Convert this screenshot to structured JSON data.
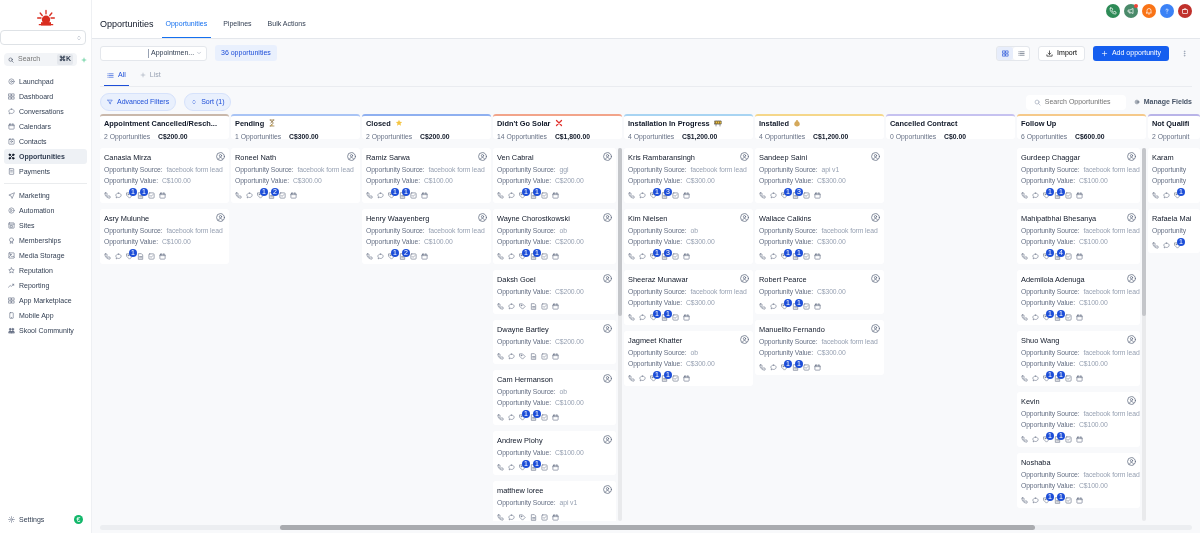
{
  "sidebar": {
    "search": {
      "placeholder": "Search",
      "shortcut": "⌘K"
    },
    "sections": [
      {
        "items": [
          {
            "label": "Launchpad",
            "selected": false
          },
          {
            "label": "Dashboard",
            "selected": false
          },
          {
            "label": "Conversations",
            "selected": false
          },
          {
            "label": "Calendars",
            "selected": false
          },
          {
            "label": "Contacts",
            "selected": false
          },
          {
            "label": "Opportunities",
            "selected": true
          },
          {
            "label": "Payments",
            "selected": false
          }
        ]
      },
      {
        "items": [
          {
            "label": "Marketing",
            "selected": false
          },
          {
            "label": "Automation",
            "selected": false
          },
          {
            "label": "Sites",
            "selected": false
          },
          {
            "label": "Memberships",
            "selected": false
          },
          {
            "label": "Media Storage",
            "selected": false
          },
          {
            "label": "Reputation",
            "selected": false
          },
          {
            "label": "Reporting",
            "selected": false
          },
          {
            "label": "App Marketplace",
            "selected": false
          },
          {
            "label": "Mobile App",
            "selected": false
          },
          {
            "label": "Skool Community",
            "selected": false
          }
        ]
      }
    ],
    "settings": {
      "label": "Settings",
      "badge": "€"
    }
  },
  "header": {
    "title": "Opportunities",
    "tabs": [
      {
        "label": "Opportunities",
        "selected": true
      },
      {
        "label": "Pipelines",
        "selected": false
      },
      {
        "label": "Bulk Actions",
        "selected": false
      }
    ]
  },
  "toolbar": {
    "pipeline": "Appointmen...",
    "count": "36 opportunities",
    "views": [
      {
        "kind": "grid",
        "selected": true
      },
      {
        "kind": "list",
        "selected": false
      }
    ],
    "import": "Import",
    "add": "Add opportunity"
  },
  "subtabs": [
    {
      "label": "All",
      "selected": true,
      "disabled": false
    },
    {
      "label": "List",
      "selected": false,
      "disabled": true
    }
  ],
  "filters": {
    "advanced": "Advanced Filters",
    "sort": "Sort (1)",
    "search_placeholder": "Search Opportunities",
    "manage": "Manage Fields"
  },
  "columns": [
    {
      "title": "Appointment Cancelled/Resch...",
      "color": "#c9b8ab",
      "count": "2 Opportunities",
      "total": "C$200.00",
      "cards": [
        {
          "name": "Canasia Mirza",
          "fields": [
            {
              "label": "Opportunity Source:",
              "value": "facebook form lead"
            },
            {
              "label": "Opportunity Value:",
              "value": "C$100.00"
            }
          ],
          "tag_badge": "1",
          "note_badge": "1"
        },
        {
          "name": "Asry Mulunhe",
          "fields": [
            {
              "label": "Opportunity Source:",
              "value": "facebook form lead"
            },
            {
              "label": "Opportunity Value:",
              "value": "C$100.00"
            }
          ],
          "tag_badge": "1"
        }
      ]
    },
    {
      "title": "Pending",
      "color": "#a9c4f5",
      "count": "1 Opportunities",
      "total": "C$300.00",
      "cards": [
        {
          "name": "Roneel Nath",
          "fields": [
            {
              "label": "Opportunity Source:",
              "value": "facebook form lead"
            },
            {
              "label": "Opportunity Value:",
              "value": "C$300.00"
            }
          ],
          "tag_badge": "1",
          "note_badge": "2"
        }
      ]
    },
    {
      "title": "Closed",
      "color": "#8fb0f0",
      "count": "2 Opportunities",
      "total": "C$200.00",
      "cards": [
        {
          "name": "Ramiz Sarwa",
          "fields": [
            {
              "label": "Opportunity Source:",
              "value": "facebook form lead"
            },
            {
              "label": "Opportunity Value:",
              "value": "C$100.00"
            }
          ],
          "tag_badge": "1",
          "note_badge": "1"
        },
        {
          "name": "Henry Waayenberg",
          "fields": [
            {
              "label": "Opportunity Source:",
              "value": "facebook form lead"
            },
            {
              "label": "Opportunity Value:",
              "value": "C$100.00"
            }
          ],
          "tag_badge": "1",
          "note_badge": "2"
        }
      ]
    },
    {
      "title": "Didn't Go Solar",
      "color": "#f2a48a",
      "count": "14 Opportunities",
      "total": "C$1,800.00",
      "cards": [
        {
          "name": "Ven Cabral",
          "fields": [
            {
              "label": "Opportunity Source:",
              "value": "ggl"
            },
            {
              "label": "Opportunity Value:",
              "value": "C$200.00"
            }
          ],
          "tag_badge": "1",
          "note_badge": "1"
        },
        {
          "name": "Wayne Chorostkowski",
          "fields": [
            {
              "label": "Opportunity Source:",
              "value": "ob"
            },
            {
              "label": "Opportunity Value:",
              "value": "C$200.00"
            }
          ],
          "tag_badge": "1",
          "note_badge": "1"
        },
        {
          "name": "Daksh Goel",
          "fields": [
            {
              "label": "Opportunity Value:",
              "value": "C$200.00"
            }
          ]
        },
        {
          "name": "Dwayne Bartley",
          "fields": [
            {
              "label": "Opportunity Value:",
              "value": "C$200.00"
            }
          ]
        },
        {
          "name": "Cam Hermanson",
          "fields": [
            {
              "label": "Opportunity Source:",
              "value": "ob"
            },
            {
              "label": "Opportunity Value:",
              "value": "C$100.00"
            }
          ],
          "tag_badge": "1",
          "note_badge": "1"
        },
        {
          "name": "Andrew Plohy",
          "fields": [
            {
              "label": "Opportunity Value:",
              "value": "C$100.00"
            }
          ],
          "tag_badge": "1",
          "note_badge": "1"
        },
        {
          "name": "matthew loree",
          "fields": [
            {
              "label": "Opportunity Source:",
              "value": "api v1"
            }
          ]
        }
      ]
    },
    {
      "title": "Installation In Progress",
      "color": "#a8d4f2",
      "count": "4 Opportunities",
      "total": "C$1,200.00",
      "cards": [
        {
          "name": "Kris Rambaransingh",
          "fields": [
            {
              "label": "Opportunity Source:",
              "value": "facebook form lead"
            },
            {
              "label": "Opportunity Value:",
              "value": "C$300.00"
            }
          ],
          "tag_badge": "1",
          "note_badge": "3"
        },
        {
          "name": "Kim Nielsen",
          "fields": [
            {
              "label": "Opportunity Source:",
              "value": "ob"
            },
            {
              "label": "Opportunity Value:",
              "value": "C$300.00"
            }
          ],
          "tag_badge": "1",
          "note_badge": "3"
        },
        {
          "name": "Sheeraz Munawar",
          "fields": [
            {
              "label": "Opportunity Source:",
              "value": "facebook form lead"
            },
            {
              "label": "Opportunity Value:",
              "value": "C$300.00"
            }
          ],
          "tag_badge": "1",
          "note_badge": "1"
        },
        {
          "name": "Jagmeet Khatter",
          "fields": [
            {
              "label": "Opportunity Source:",
              "value": "ob"
            },
            {
              "label": "Opportunity Value:",
              "value": "C$300.00"
            }
          ],
          "tag_badge": "1",
          "note_badge": "1"
        }
      ]
    },
    {
      "title": "Installed",
      "color": "#f5d78a",
      "count": "4 Opportunities",
      "total": "C$1,200.00",
      "cards": [
        {
          "name": "Sandeep Saini",
          "fields": [
            {
              "label": "Opportunity Source:",
              "value": "api v1"
            },
            {
              "label": "Opportunity Value:",
              "value": "C$300.00"
            }
          ],
          "tag_badge": "1",
          "note_badge": "3"
        },
        {
          "name": "Wallace Calkins",
          "fields": [
            {
              "label": "Opportunity Source:",
              "value": "facebook form lead"
            },
            {
              "label": "Opportunity Value:",
              "value": "C$300.00"
            }
          ],
          "tag_badge": "1",
          "note_badge": "1"
        },
        {
          "name": "Robert Pearce",
          "fields": [
            {
              "label": "Opportunity Value:",
              "value": "C$300.00"
            }
          ],
          "tag_badge": "1",
          "note_badge": "1"
        },
        {
          "name": "Manuelito Fernando",
          "fields": [
            {
              "label": "Opportunity Source:",
              "value": "facebook form lead"
            },
            {
              "label": "Opportunity Value:",
              "value": "C$300.00"
            }
          ],
          "tag_badge": "1",
          "note_badge": "1"
        }
      ]
    },
    {
      "title": "Cancelled Contract",
      "color": "#c6c2f0",
      "count": "0 Opportunities",
      "total": "C$0.00"
    },
    {
      "title": "Follow Up",
      "color": "#f5c98a",
      "count": "6 Opportunities",
      "total": "C$600.00",
      "cards": [
        {
          "name": "Gurdeep Chaggar",
          "fields": [
            {
              "label": "Opportunity Source:",
              "value": "facebook form lead"
            },
            {
              "label": "Opportunity Value:",
              "value": "C$100.00"
            }
          ],
          "tag_badge": "1",
          "note_badge": "1"
        },
        {
          "name": "Mahipatbhai Bhesanya",
          "fields": [
            {
              "label": "Opportunity Source:",
              "value": "facebook form lead"
            },
            {
              "label": "Opportunity Value:",
              "value": "C$100.00"
            }
          ],
          "tag_badge": "1",
          "note_badge": "4"
        },
        {
          "name": "Ademilola Adenuga",
          "fields": [
            {
              "label": "Opportunity Source:",
              "value": "facebook form lead"
            },
            {
              "label": "Opportunity Value:",
              "value": "C$100.00"
            }
          ],
          "tag_badge": "1",
          "note_badge": "1"
        },
        {
          "name": "Shuo Wang",
          "fields": [
            {
              "label": "Opportunity Source:",
              "value": "facebook form lead"
            },
            {
              "label": "Opportunity Value:",
              "value": "C$100.00"
            }
          ],
          "tag_badge": "1",
          "note_badge": "1"
        },
        {
          "name": "Kevin",
          "fields": [
            {
              "label": "Opportunity Source:",
              "value": "facebook form lead"
            },
            {
              "label": "Opportunity Value:",
              "value": "C$100.00"
            }
          ],
          "tag_badge": "1",
          "note_badge": "1"
        },
        {
          "name": "Noshaba",
          "fields": [
            {
              "label": "Opportunity Source:",
              "value": "facebook form lead"
            },
            {
              "label": "Opportunity Value:",
              "value": "C$100.00"
            }
          ],
          "tag_badge": "1",
          "note_badge": "1"
        }
      ]
    },
    {
      "title": "Not Qualifi",
      "color": "#b9b4e8",
      "count": "2 Opportunit",
      "cards": [
        {
          "name": "Karam",
          "fields": [
            {
              "label": "Opportunity"
            },
            {
              "label": "Opportunity"
            }
          ],
          "tag_badge": "1"
        },
        {
          "name": "Rafaela Mai",
          "fields": [
            {
              "label": "Opportunity"
            }
          ],
          "tag_badge": "1"
        }
      ]
    }
  ]
}
